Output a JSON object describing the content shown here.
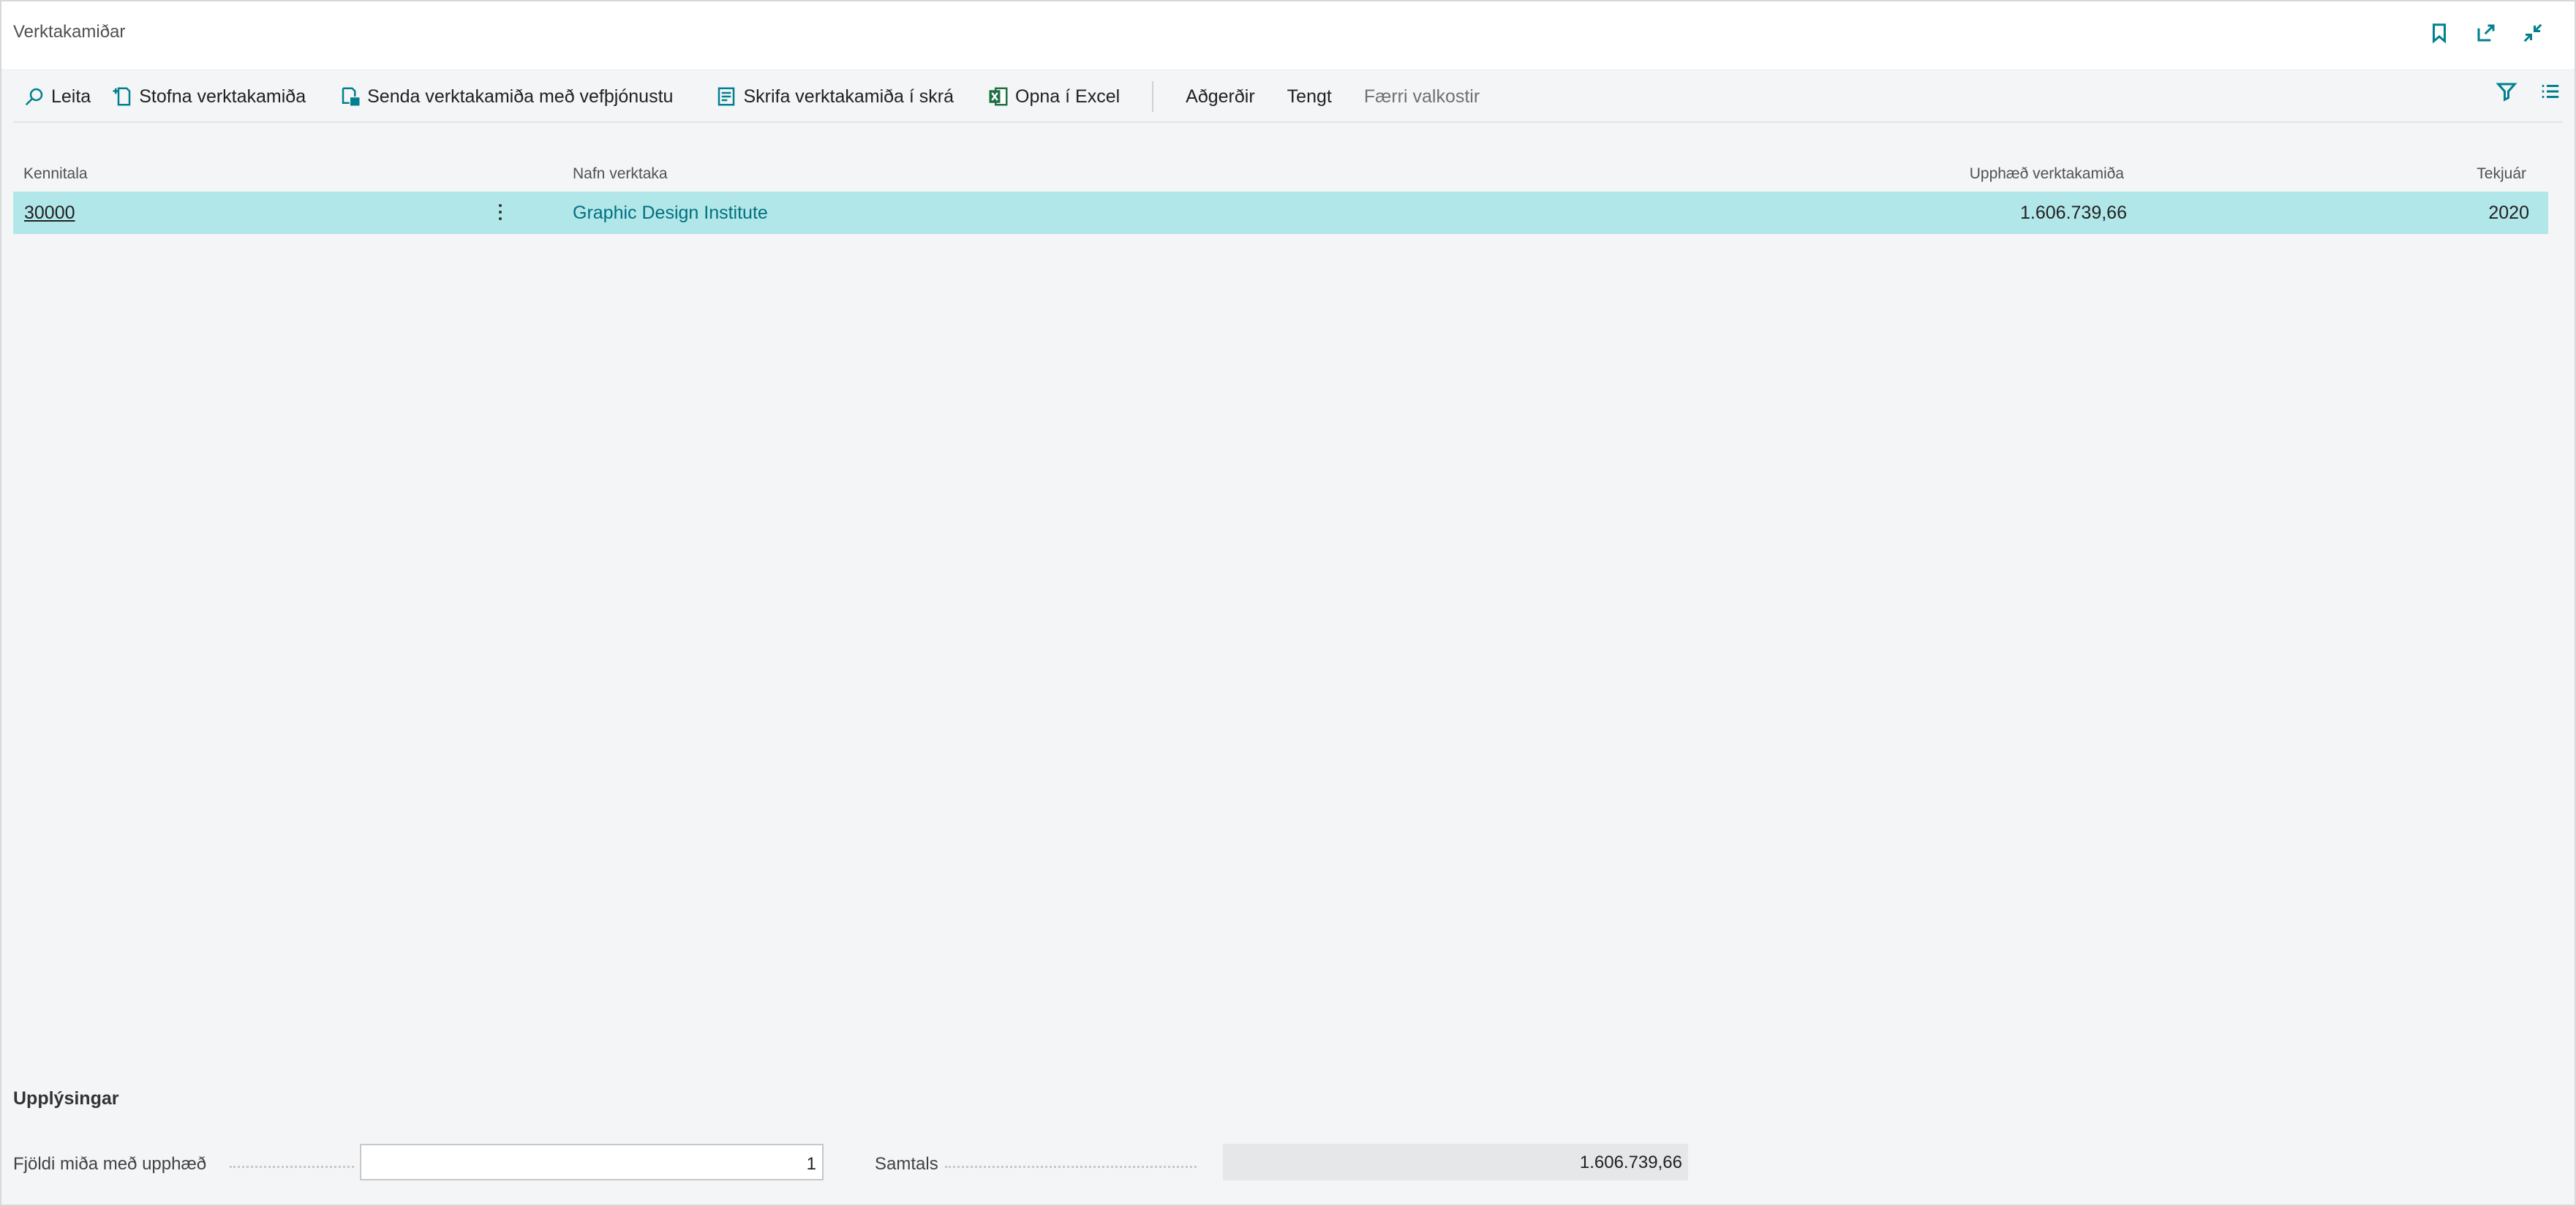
{
  "window": {
    "title": "Verktakamiðar"
  },
  "toolbar": {
    "search_label": "Leita",
    "create_label": "Stofna verktakamiða",
    "send_label": "Senda verktakamiða með vefþjónustu",
    "write_label": "Skrifa verktakamiða í skrá",
    "excel_label": "Opna í Excel",
    "actions_label": "Aðgerðir",
    "related_label": "Tengt",
    "fewer_label": "Færri valkostir"
  },
  "table": {
    "columns": [
      "Kennitala",
      "Nafn verktaka",
      "Upphæð verktakamiða",
      "Tekjuár"
    ],
    "rows": [
      {
        "kennitala": "30000",
        "nafn": "Graphic Design Institute",
        "upphaed": "1.606.739,66",
        "tekjuar": "2020"
      }
    ]
  },
  "info": {
    "title": "Upplýsingar",
    "count_label": "Fjöldi miða með upphæð",
    "count_value": "1",
    "total_label": "Samtals",
    "total_value": "1.606.739,66"
  },
  "colors": {
    "accent": "#00808f",
    "row_selected": "#b2e7e9",
    "excel_green": "#1e7145"
  },
  "icons": [
    "bookmark-icon",
    "open-new-window-icon",
    "collapse-icon",
    "search-icon",
    "new-document-icon",
    "send-icon",
    "write-file-icon",
    "excel-icon",
    "filter-icon",
    "list-icon",
    "row-menu-icon"
  ]
}
